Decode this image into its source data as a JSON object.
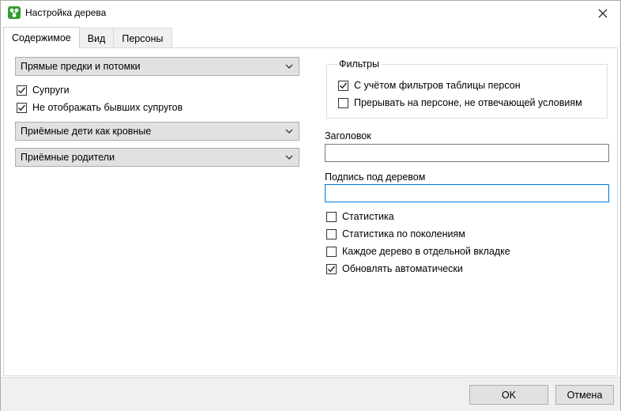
{
  "window": {
    "title": "Настройка дерева",
    "icon": "family-tree-app-icon"
  },
  "tabs": [
    {
      "label": "Содержимое",
      "active": true
    },
    {
      "label": "Вид",
      "active": false
    },
    {
      "label": "Персоны",
      "active": false
    }
  ],
  "left": {
    "relatives_combo": "Прямые предки и потомки",
    "spouses": {
      "label": "Супруги",
      "checked": true
    },
    "hide_ex_spouses": {
      "label": "Не отображать бывших супругов",
      "checked": true
    },
    "adopted_children_combo": "Приёмные дети как кровные",
    "adoptive_parents_combo": "Приёмные родители"
  },
  "filters": {
    "legend": "Фильтры",
    "use_table_filters": {
      "label": "С учётом фильтров таблицы персон",
      "checked": true
    },
    "stop_on_mismatch": {
      "label": "Прерывать на персоне, не отвечающей условиям",
      "checked": false
    }
  },
  "header_field": {
    "label": "Заголовок",
    "value": ""
  },
  "caption_field": {
    "label": "Подпись под деревом",
    "value": ""
  },
  "options": {
    "statistics": {
      "label": "Статистика",
      "checked": false
    },
    "stats_by_generation": {
      "label": "Статистика по поколениям",
      "checked": false
    },
    "separate_tab": {
      "label": "Каждое дерево в отдельной вкладке",
      "checked": false
    },
    "auto_update": {
      "label": "Обновлять автоматически",
      "checked": true
    }
  },
  "buttons": {
    "ok": "OK",
    "cancel": "Отмена"
  },
  "colors": {
    "focus": "#0078d7",
    "footer": "#f0f0f0",
    "app_icon": "#2e9e2e"
  }
}
